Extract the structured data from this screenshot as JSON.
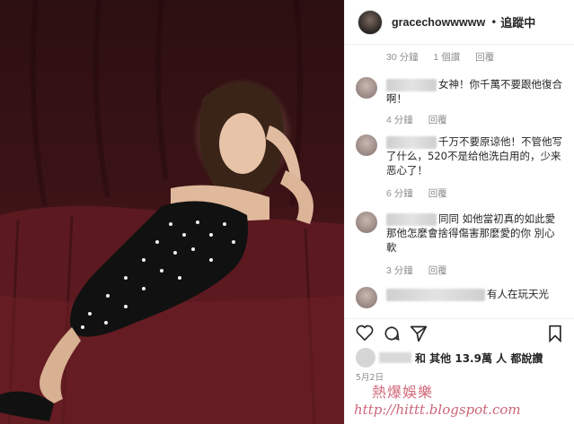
{
  "header": {
    "username": "gracechowwwww",
    "separator": "•",
    "follow_label": "追蹤中"
  },
  "comments": [
    {
      "id": "c0",
      "time": "30 分鐘",
      "likes": "1 個讚",
      "reply": "回覆"
    },
    {
      "id": "c1",
      "text": "女神！你千萬不要跟他復合啊！",
      "time": "4 分鐘",
      "reply": "回覆"
    },
    {
      "id": "c2",
      "text": "千万不要原谅他！不管他写了什么，520不是给他洗白用的，少来恶心了！",
      "time": "6 分鐘",
      "reply": "回覆"
    },
    {
      "id": "c3",
      "text": "同同 如他當初真的如此愛 那他怎麼會捨得傷害那麼愛的你 別心軟",
      "time": "3 分鐘",
      "reply": "回覆"
    },
    {
      "id": "c4",
      "text": "有人在玩天光"
    }
  ],
  "actions": {
    "like": "heart-icon",
    "comment": "comment-icon",
    "share": "share-icon",
    "save": "bookmark-icon"
  },
  "likes": {
    "text": "和 其他 13.9萬 人 都說讚"
  },
  "date": "5月2日",
  "watermark": {
    "title": "熱爆娛樂",
    "url": "http://hittt.blogspot.com"
  }
}
